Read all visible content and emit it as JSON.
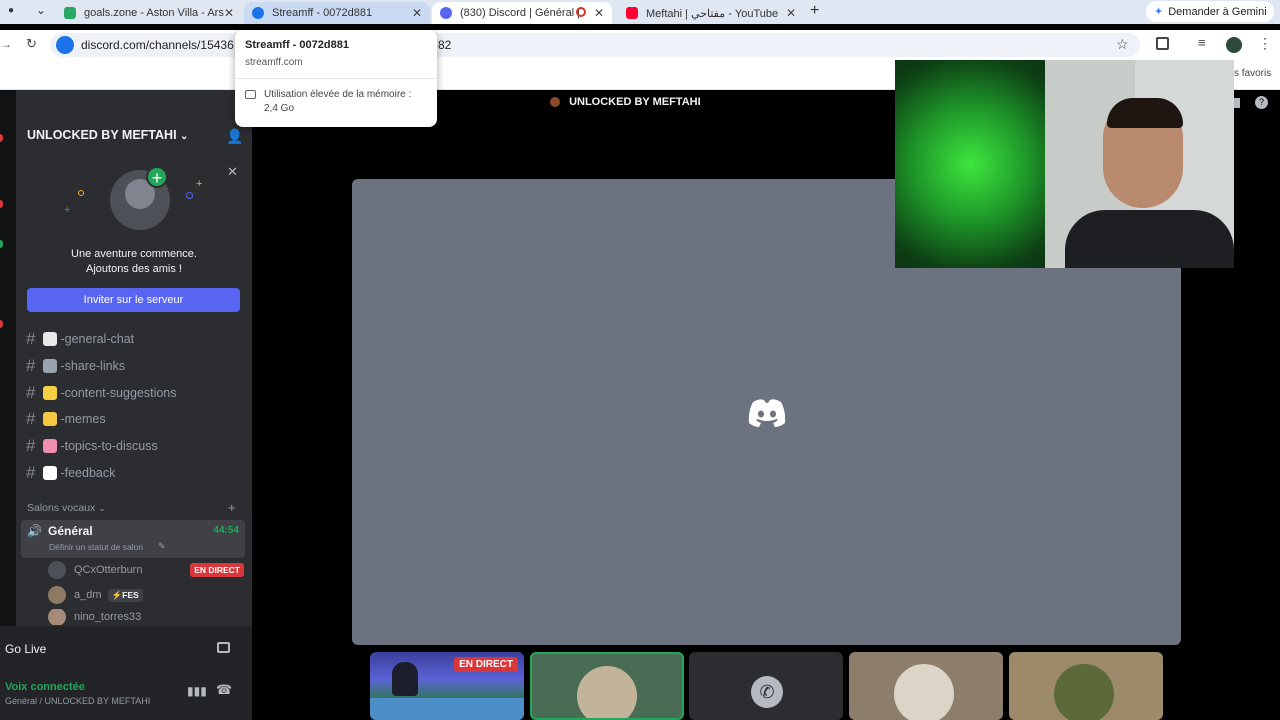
{
  "browser": {
    "tabs": [
      {
        "title": "goals.zone - Aston Villa - Ars"
      },
      {
        "title": "Streamff - 0072d881"
      },
      {
        "title": "(830) Discord | Général | "
      },
      {
        "title": "Meftahi | مفتاحي - YouTube"
      }
    ],
    "gemini_label": "Demander à Gemini",
    "url_visible": "discord.com/channels/15436",
    "url_suffix": "82",
    "favorites_label": "s favoris",
    "tooltip": {
      "title": "Streamff - 0072d881",
      "domain": "streamff.com",
      "memory_line1": "Utilisation élevée de la mémoire :",
      "memory_line2": "2,4 Go"
    }
  },
  "discord": {
    "top_title": "UNLOCKED BY MEFTAHI",
    "server_name": "UNLOCKED BY MEFTAHI",
    "invite_card": {
      "line1": "Une aventure commence.",
      "line2": "Ajoutons des amis !",
      "button": "Inviter sur le serveur"
    },
    "channels": [
      {
        "name": "-general-chat",
        "emoji_color": "#e8e8e8"
      },
      {
        "name": "-share-links",
        "emoji_color": "#9aa4b0"
      },
      {
        "name": "-content-suggestions",
        "emoji_color": "#f5d142"
      },
      {
        "name": "-memes",
        "emoji_color": "#f5c842"
      },
      {
        "name": "-topics-to-discuss",
        "emoji_color": "#f08fb0"
      },
      {
        "name": "-feedback",
        "emoji_color": "#ffffff"
      }
    ],
    "voice_section": "Salons vocaux",
    "voice_channel": {
      "name": "Général",
      "timer": "44:54",
      "status_placeholder": "Définir un statut de salon"
    },
    "voice_users": [
      {
        "name": "QCxOtterburn",
        "badge": "EN DIRECT"
      },
      {
        "name": "a_dm",
        "tag": "FES"
      },
      {
        "name": "nino_torres33"
      }
    ],
    "go_live": "Go Live",
    "voice_connected": "Voix connectée",
    "voice_location": "Général / UNLOCKED BY MEFTAHI",
    "stream_tiles": [
      {
        "kind": "live-stream",
        "badge": "EN DIRECT"
      },
      {
        "kind": "avatar"
      },
      {
        "kind": "call"
      },
      {
        "kind": "avatar"
      },
      {
        "kind": "avatar"
      }
    ],
    "colors": {
      "blurple": "#5865f2",
      "live_red": "#da373c",
      "green": "#23a55a"
    }
  }
}
